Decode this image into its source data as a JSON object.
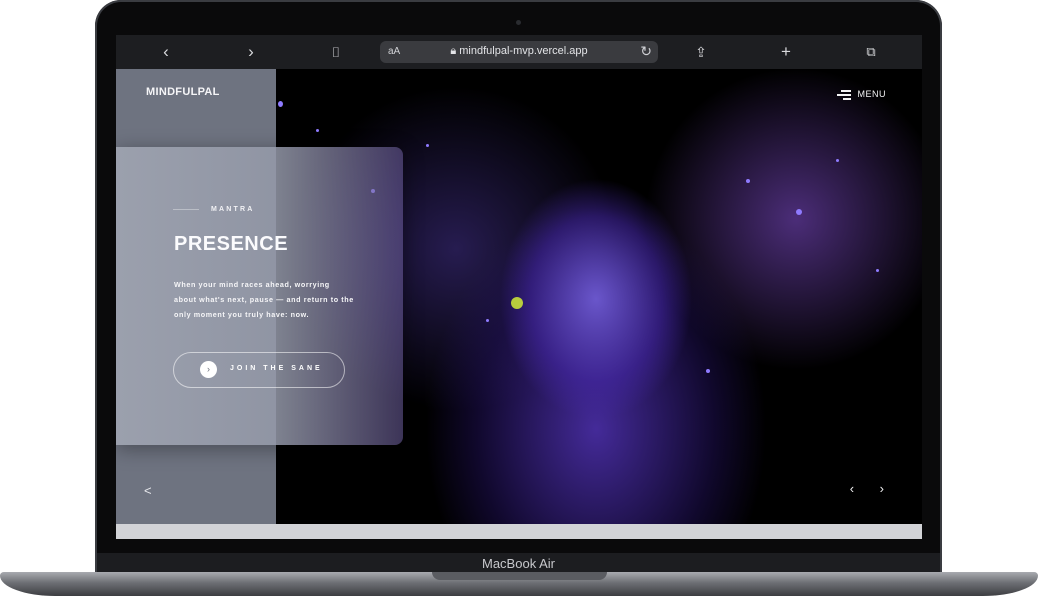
{
  "device": {
    "label": "MacBook Air"
  },
  "browser": {
    "back_icon": "chevron-left-icon",
    "forward_icon": "chevron-right-icon",
    "bookmarks_icon": "book-icon",
    "text_size": "aA",
    "url": "mindfulpal-mvp.vercel.app",
    "reload_icon": "reload-icon",
    "share_icon": "share-icon",
    "new_tab_icon": "plus-icon",
    "tabs_icon": "tabs-icon"
  },
  "site": {
    "brand": "MINDFULPAL",
    "menu_label": "MENU",
    "card": {
      "kicker": "MANTRA",
      "title": "PRESENCE",
      "description": "When your mind races ahead, worrying about what's next, pause — and return to the only moment you truly have: now.",
      "cta_label": "JOIN THE SANE"
    },
    "share_icon": "share-nodes-icon",
    "prev_icon": "chevron-left-icon",
    "next_icon": "chevron-right-icon"
  },
  "colors": {
    "sidebar": "#6e7380",
    "hero_accent": "#6a4bd6",
    "cursor": "#c8e03a"
  }
}
